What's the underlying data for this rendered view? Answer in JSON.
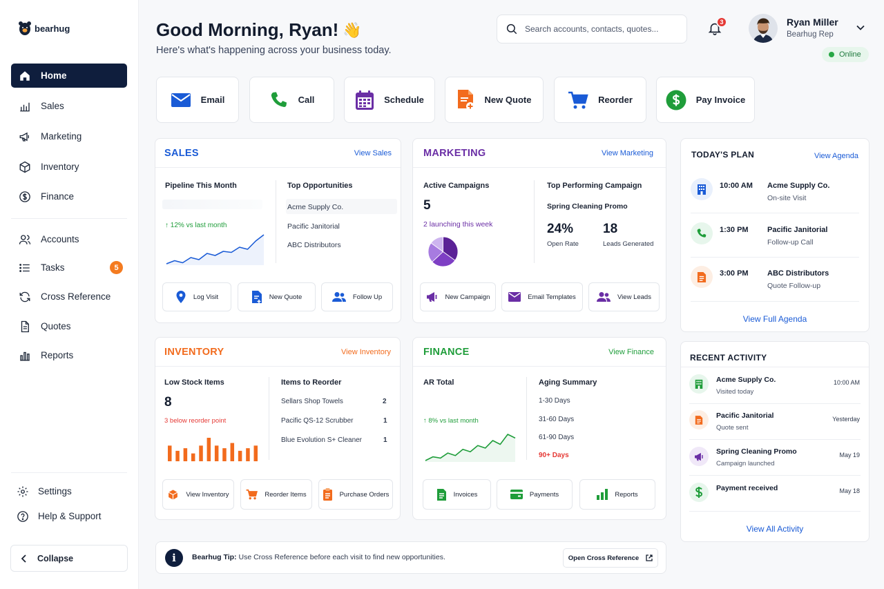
{
  "app": {
    "logo_text": "bearhug"
  },
  "colors": {
    "navy": "#0f1e3d",
    "blue": "#1a5bd6",
    "purple": "#6a2ea5",
    "orange": "#f26b1d",
    "green": "#1f9d3a",
    "red": "#e53935"
  },
  "sidebar": {
    "items": [
      {
        "label": "Home",
        "icon": "home-icon",
        "active": true
      },
      {
        "label": "Sales",
        "icon": "bar-chart-icon"
      },
      {
        "label": "Marketing",
        "icon": "megaphone-icon"
      },
      {
        "label": "Inventory",
        "icon": "box-icon"
      },
      {
        "label": "Finance",
        "icon": "dollar-circle-icon"
      },
      {
        "label": "Accounts",
        "icon": "users-icon"
      },
      {
        "label": "Tasks",
        "icon": "list-icon",
        "badge": "5"
      },
      {
        "label": "Cross Reference",
        "icon": "refresh-icon"
      },
      {
        "label": "Quotes",
        "icon": "document-icon"
      },
      {
        "label": "Reports",
        "icon": "reports-icon"
      }
    ],
    "settings": "Settings",
    "help": "Help & Support",
    "collapse": "Collapse"
  },
  "header": {
    "greeting": "Good Morning, Ryan!",
    "greeting_emoji": "👋",
    "subtitle": "Here's what's happening across your business today.",
    "search_placeholder": "Search accounts, contacts, quotes...",
    "notifications": "3",
    "user_name": "Ryan Miller",
    "user_role": "Bearhug Rep",
    "status": "Online"
  },
  "quick_actions": [
    {
      "label": "Email",
      "icon": "mail-icon"
    },
    {
      "label": "Call",
      "icon": "phone-icon"
    },
    {
      "label": "Schedule",
      "icon": "calendar-icon"
    },
    {
      "label": "New Quote",
      "icon": "new-quote-icon"
    },
    {
      "label": "Reorder",
      "icon": "cart-icon"
    },
    {
      "label": "Pay Invoice",
      "icon": "dollar-icon"
    }
  ],
  "sales": {
    "title": "SALES",
    "link": "View Sales",
    "pipeline_label": "Pipeline This Month",
    "trend": "12% vs last month",
    "top_label": "Top Opportunities",
    "opportunities": [
      "Acme Supply Co.",
      "Pacific Janitorial",
      "ABC Distributors"
    ],
    "actions": [
      "Log Visit",
      "New Quote",
      "Follow Up"
    ]
  },
  "marketing": {
    "title": "MARKETING",
    "link": "View Marketing",
    "active_label": "Active Campaigns",
    "active_value": "5",
    "launching": "2 launching this week",
    "top_label": "Top Performing Campaign",
    "top_campaign": "Spring Cleaning Promo",
    "open_rate": "24%",
    "open_rate_label": "Open Rate",
    "leads": "18",
    "leads_label": "Leads Generated",
    "actions": [
      "New Campaign",
      "Email Templates",
      "View Leads"
    ]
  },
  "inventory": {
    "title": "INVENTORY",
    "link": "View Inventory",
    "low_label": "Low Stock Items",
    "low_value": "8",
    "below": "3 below reorder point",
    "reorder_label": "Items to Reorder",
    "reorder_items": [
      {
        "name": "Sellars Shop Towels",
        "qty": "2"
      },
      {
        "name": "Pacific QS-12 Scrubber",
        "qty": "1"
      },
      {
        "name": "Blue Evolution S+ Cleaner",
        "qty": "1"
      }
    ],
    "actions": [
      "View Inventory",
      "Reorder Items",
      "Purchase Orders"
    ]
  },
  "finance": {
    "title": "FINANCE",
    "link": "View Finance",
    "ar_label": "AR Total",
    "trend": "8% vs last month",
    "aging_label": "Aging Summary",
    "aging": [
      "1-30 Days",
      "31-60 Days",
      "61-90 Days",
      "90+ Days"
    ],
    "actions": [
      "Invoices",
      "Payments",
      "Reports"
    ]
  },
  "plan": {
    "title": "TODAY'S PLAN",
    "link": "View Agenda",
    "items": [
      {
        "time": "10:00 AM",
        "name": "Acme Supply Co.",
        "sub": "On-site Visit",
        "icon": "building-icon"
      },
      {
        "time": "1:30 PM",
        "name": "Pacific Janitorial",
        "sub": "Follow-up Call",
        "icon": "phone-icon"
      },
      {
        "time": "3:00 PM",
        "name": "ABC Distributors",
        "sub": "Quote Follow-up",
        "icon": "document-icon"
      }
    ],
    "footer": "View Full Agenda"
  },
  "activity": {
    "title": "RECENT ACTIVITY",
    "items": [
      {
        "name": "Acme Supply Co.",
        "sub": "Visited today",
        "time": "10:00 AM",
        "icon": "building-icon"
      },
      {
        "name": "Pacific Janitorial",
        "sub": "Quote sent",
        "time": "Yesterday",
        "icon": "document-icon"
      },
      {
        "name": "Spring Cleaning Promo",
        "sub": "Campaign launched",
        "time": "May 19",
        "icon": "megaphone-icon"
      },
      {
        "name": "Payment received",
        "sub": "",
        "time": "May 18",
        "icon": "dollar-icon"
      }
    ],
    "footer": "View All Activity"
  },
  "tip": {
    "label": "Bearhug Tip:",
    "text": "Use Cross Reference before each visit to find new opportunities.",
    "button": "Open Cross Reference"
  },
  "chart_data": [
    {
      "type": "line",
      "title": "Pipeline This Month",
      "values": [
        2,
        2.3,
        2.1,
        2.6,
        2.4,
        3.0,
        2.8,
        3.2,
        3.1,
        3.6,
        3.4,
        4.2,
        4.8
      ]
    },
    {
      "type": "pie",
      "title": "Active Campaigns",
      "values": [
        35,
        28,
        22,
        15
      ]
    },
    {
      "type": "bar",
      "title": "Low Stock Items",
      "values": [
        6,
        4,
        5,
        3,
        6,
        9,
        6,
        5,
        7,
        4,
        5,
        6
      ]
    },
    {
      "type": "line",
      "title": "AR Total",
      "values": [
        1.0,
        1.3,
        1.2,
        1.6,
        1.4,
        1.9,
        1.7,
        2.2,
        2.0,
        2.6,
        2.3,
        3.1,
        2.8
      ]
    }
  ]
}
